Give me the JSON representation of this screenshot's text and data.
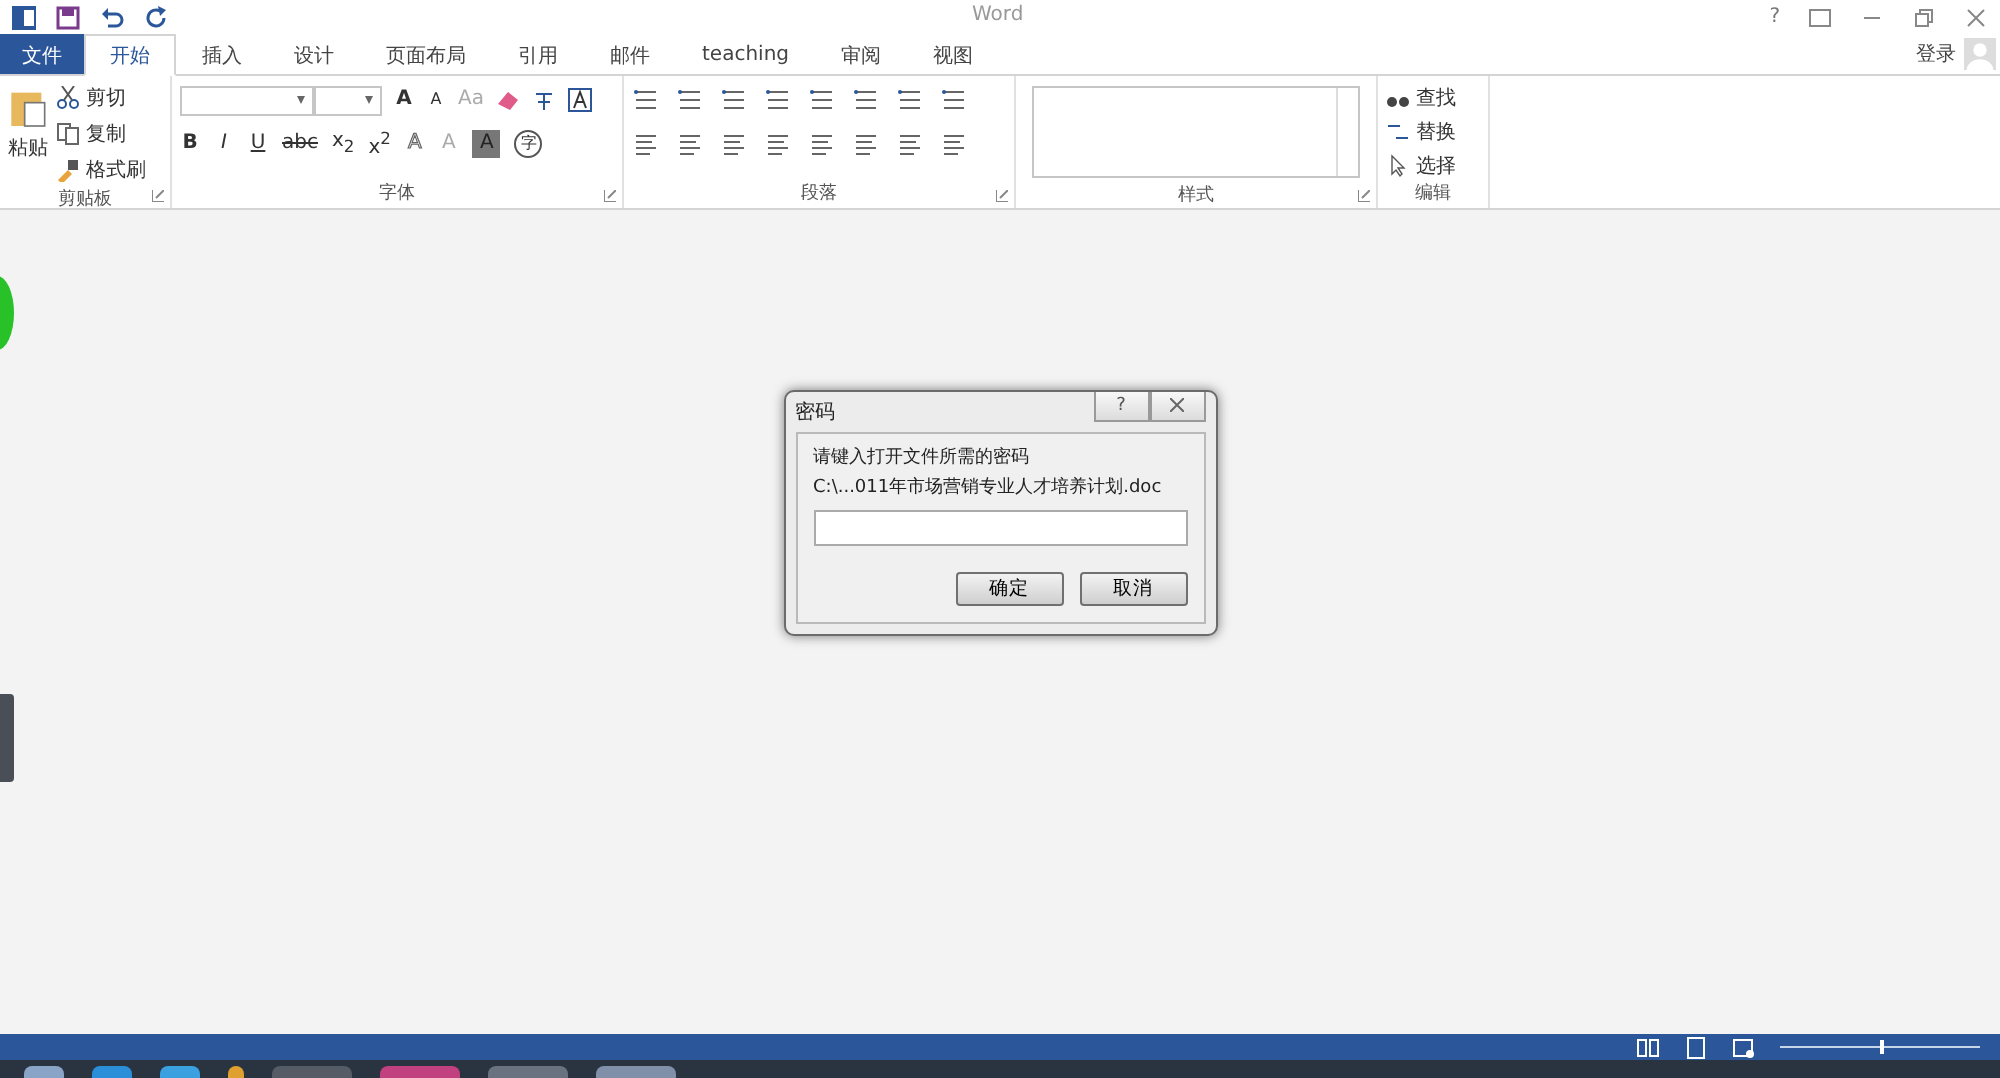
{
  "title_bar": {
    "title": "Word",
    "help": "?"
  },
  "tabs": [
    {
      "label": "文件",
      "kind": "file",
      "selected": false
    },
    {
      "label": "开始",
      "kind": "tab",
      "selected": true
    },
    {
      "label": "插入",
      "kind": "tab",
      "selected": false
    },
    {
      "label": "设计",
      "kind": "tab",
      "selected": false
    },
    {
      "label": "页面布局",
      "kind": "tab",
      "selected": false
    },
    {
      "label": "引用",
      "kind": "tab",
      "selected": false
    },
    {
      "label": "邮件",
      "kind": "tab",
      "selected": false
    },
    {
      "label": "teaching",
      "kind": "tab",
      "selected": false
    },
    {
      "label": "审阅",
      "kind": "tab",
      "selected": false
    },
    {
      "label": "视图",
      "kind": "tab",
      "selected": false
    }
  ],
  "account": {
    "label": "登录"
  },
  "clipboard": {
    "paste": "粘贴",
    "cut": "剪切",
    "copy": "复制",
    "format_painter": "格式刷",
    "label": "剪贴板"
  },
  "font": {
    "label": "字体",
    "row_1": [
      {
        "text": "A",
        "kind": "grow"
      },
      {
        "text": "A",
        "kind": "shrink"
      },
      {
        "text": "Aa",
        "kind": "grey"
      }
    ],
    "row_2": [
      {
        "text": "B",
        "kind": "bold"
      },
      {
        "text": "I",
        "kind": "italic"
      },
      {
        "text": "U",
        "kind": "underline"
      },
      {
        "text": "abc",
        "kind": "strike"
      },
      {
        "text": "x$_{2}$",
        "kind": "plain"
      },
      {
        "text": "x$^{2}$",
        "kind": "plain"
      },
      {
        "text": "A",
        "kind": "outline"
      },
      {
        "text": "A",
        "kind": "grey"
      },
      {
        "text": "A",
        "kind": "shaded"
      },
      {
        "text": "字",
        "kind": "circled"
      }
    ]
  },
  "paragraph": {
    "label": "段落"
  },
  "styles": {
    "label": "样式"
  },
  "editing": {
    "label": "编辑",
    "items": [
      "查找",
      "替换",
      "选择"
    ]
  },
  "dialog": {
    "title": "密码",
    "help": "?",
    "prompt": "请键入打开文件所需的密码",
    "path": "C:\\...011年市场营销专业人才培养计划.doc",
    "buttons": [
      "确定",
      "取消"
    ]
  },
  "zoom": {
    "level": 0.5
  }
}
